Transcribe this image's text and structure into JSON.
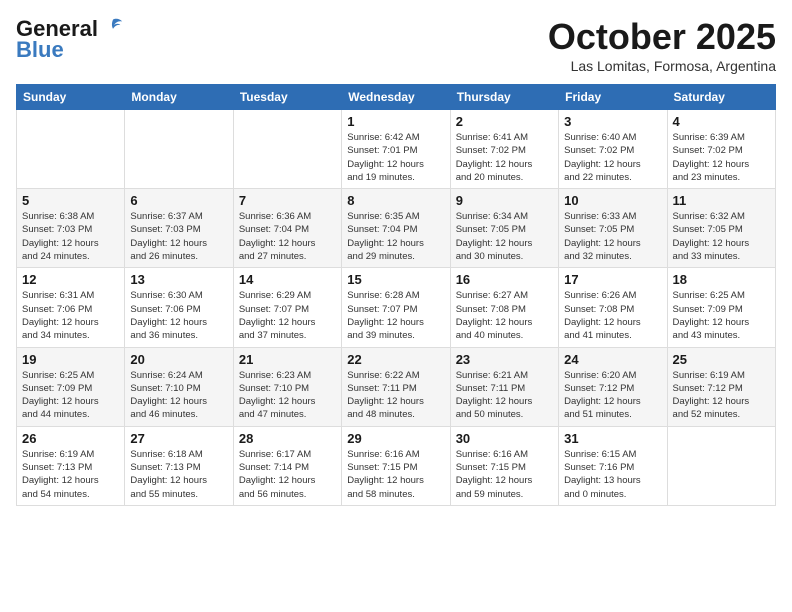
{
  "header": {
    "logo_general": "General",
    "logo_blue": "Blue",
    "month": "October 2025",
    "location": "Las Lomitas, Formosa, Argentina"
  },
  "weekdays": [
    "Sunday",
    "Monday",
    "Tuesday",
    "Wednesday",
    "Thursday",
    "Friday",
    "Saturday"
  ],
  "weeks": [
    [
      {
        "day": "",
        "info": ""
      },
      {
        "day": "",
        "info": ""
      },
      {
        "day": "",
        "info": ""
      },
      {
        "day": "1",
        "info": "Sunrise: 6:42 AM\nSunset: 7:01 PM\nDaylight: 12 hours\nand 19 minutes."
      },
      {
        "day": "2",
        "info": "Sunrise: 6:41 AM\nSunset: 7:02 PM\nDaylight: 12 hours\nand 20 minutes."
      },
      {
        "day": "3",
        "info": "Sunrise: 6:40 AM\nSunset: 7:02 PM\nDaylight: 12 hours\nand 22 minutes."
      },
      {
        "day": "4",
        "info": "Sunrise: 6:39 AM\nSunset: 7:02 PM\nDaylight: 12 hours\nand 23 minutes."
      }
    ],
    [
      {
        "day": "5",
        "info": "Sunrise: 6:38 AM\nSunset: 7:03 PM\nDaylight: 12 hours\nand 24 minutes."
      },
      {
        "day": "6",
        "info": "Sunrise: 6:37 AM\nSunset: 7:03 PM\nDaylight: 12 hours\nand 26 minutes."
      },
      {
        "day": "7",
        "info": "Sunrise: 6:36 AM\nSunset: 7:04 PM\nDaylight: 12 hours\nand 27 minutes."
      },
      {
        "day": "8",
        "info": "Sunrise: 6:35 AM\nSunset: 7:04 PM\nDaylight: 12 hours\nand 29 minutes."
      },
      {
        "day": "9",
        "info": "Sunrise: 6:34 AM\nSunset: 7:05 PM\nDaylight: 12 hours\nand 30 minutes."
      },
      {
        "day": "10",
        "info": "Sunrise: 6:33 AM\nSunset: 7:05 PM\nDaylight: 12 hours\nand 32 minutes."
      },
      {
        "day": "11",
        "info": "Sunrise: 6:32 AM\nSunset: 7:05 PM\nDaylight: 12 hours\nand 33 minutes."
      }
    ],
    [
      {
        "day": "12",
        "info": "Sunrise: 6:31 AM\nSunset: 7:06 PM\nDaylight: 12 hours\nand 34 minutes."
      },
      {
        "day": "13",
        "info": "Sunrise: 6:30 AM\nSunset: 7:06 PM\nDaylight: 12 hours\nand 36 minutes."
      },
      {
        "day": "14",
        "info": "Sunrise: 6:29 AM\nSunset: 7:07 PM\nDaylight: 12 hours\nand 37 minutes."
      },
      {
        "day": "15",
        "info": "Sunrise: 6:28 AM\nSunset: 7:07 PM\nDaylight: 12 hours\nand 39 minutes."
      },
      {
        "day": "16",
        "info": "Sunrise: 6:27 AM\nSunset: 7:08 PM\nDaylight: 12 hours\nand 40 minutes."
      },
      {
        "day": "17",
        "info": "Sunrise: 6:26 AM\nSunset: 7:08 PM\nDaylight: 12 hours\nand 41 minutes."
      },
      {
        "day": "18",
        "info": "Sunrise: 6:25 AM\nSunset: 7:09 PM\nDaylight: 12 hours\nand 43 minutes."
      }
    ],
    [
      {
        "day": "19",
        "info": "Sunrise: 6:25 AM\nSunset: 7:09 PM\nDaylight: 12 hours\nand 44 minutes."
      },
      {
        "day": "20",
        "info": "Sunrise: 6:24 AM\nSunset: 7:10 PM\nDaylight: 12 hours\nand 46 minutes."
      },
      {
        "day": "21",
        "info": "Sunrise: 6:23 AM\nSunset: 7:10 PM\nDaylight: 12 hours\nand 47 minutes."
      },
      {
        "day": "22",
        "info": "Sunrise: 6:22 AM\nSunset: 7:11 PM\nDaylight: 12 hours\nand 48 minutes."
      },
      {
        "day": "23",
        "info": "Sunrise: 6:21 AM\nSunset: 7:11 PM\nDaylight: 12 hours\nand 50 minutes."
      },
      {
        "day": "24",
        "info": "Sunrise: 6:20 AM\nSunset: 7:12 PM\nDaylight: 12 hours\nand 51 minutes."
      },
      {
        "day": "25",
        "info": "Sunrise: 6:19 AM\nSunset: 7:12 PM\nDaylight: 12 hours\nand 52 minutes."
      }
    ],
    [
      {
        "day": "26",
        "info": "Sunrise: 6:19 AM\nSunset: 7:13 PM\nDaylight: 12 hours\nand 54 minutes."
      },
      {
        "day": "27",
        "info": "Sunrise: 6:18 AM\nSunset: 7:13 PM\nDaylight: 12 hours\nand 55 minutes."
      },
      {
        "day": "28",
        "info": "Sunrise: 6:17 AM\nSunset: 7:14 PM\nDaylight: 12 hours\nand 56 minutes."
      },
      {
        "day": "29",
        "info": "Sunrise: 6:16 AM\nSunset: 7:15 PM\nDaylight: 12 hours\nand 58 minutes."
      },
      {
        "day": "30",
        "info": "Sunrise: 6:16 AM\nSunset: 7:15 PM\nDaylight: 12 hours\nand 59 minutes."
      },
      {
        "day": "31",
        "info": "Sunrise: 6:15 AM\nSunset: 7:16 PM\nDaylight: 13 hours\nand 0 minutes."
      },
      {
        "day": "",
        "info": ""
      }
    ]
  ]
}
